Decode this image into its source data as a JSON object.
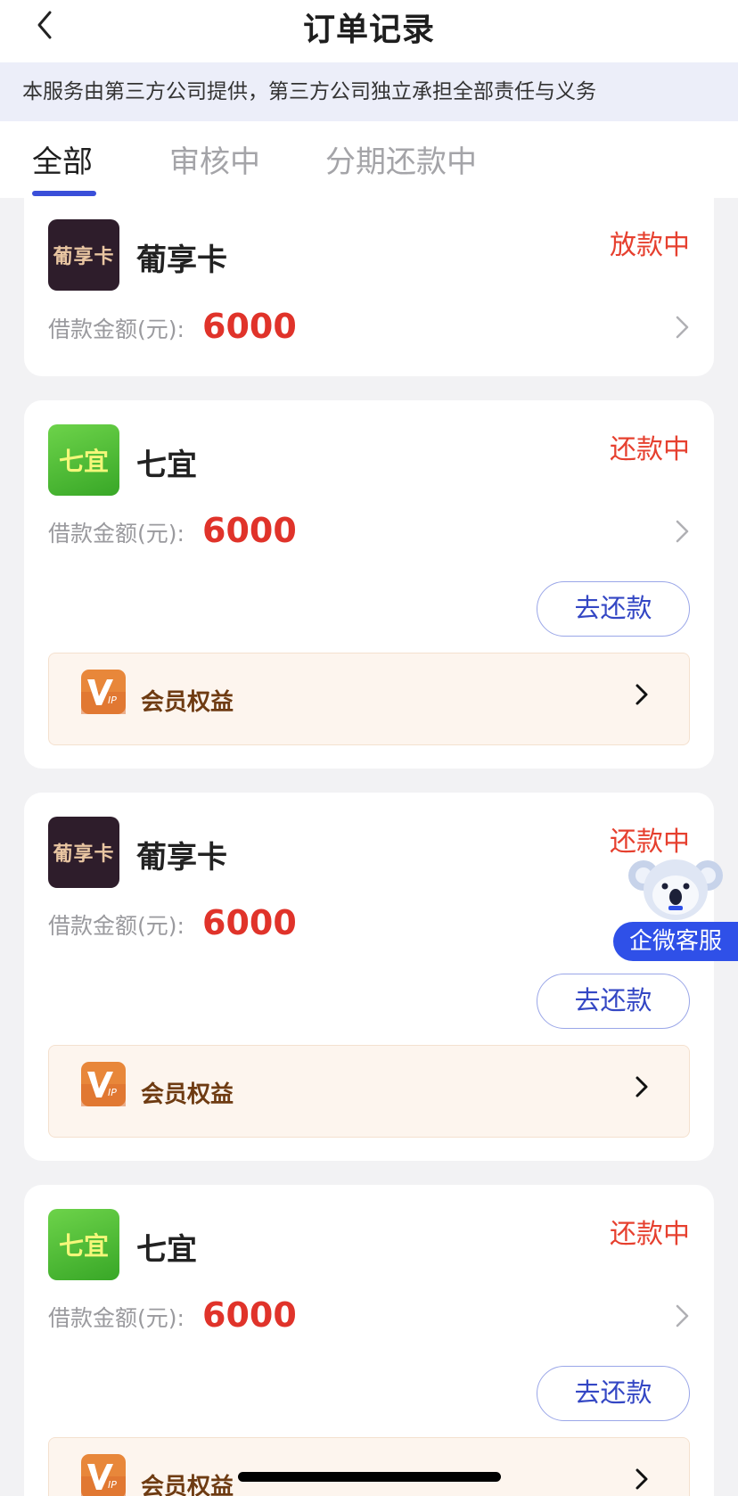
{
  "header": {
    "title": "订单记录"
  },
  "notice": "本服务由第三方公司提供，第三方公司独立承担全部责任与义务",
  "tabs": [
    {
      "label": "全部",
      "active": true
    },
    {
      "label": "审核中",
      "active": false
    },
    {
      "label": "分期还款中",
      "active": false
    }
  ],
  "orders": [
    {
      "logo_text": "葡享卡",
      "logo_style": "dark",
      "name": "葡享卡",
      "status": "放款中",
      "amount_label": "借款金额(元):",
      "amount": "6000"
    },
    {
      "logo_text": "七宜",
      "logo_style": "green",
      "name": "七宜",
      "status": "还款中",
      "amount_label": "借款金额(元):",
      "amount": "6000",
      "repay_label": "去还款",
      "vip_label": "会员权益"
    },
    {
      "logo_text": "葡享卡",
      "logo_style": "dark",
      "name": "葡享卡",
      "status": "还款中",
      "amount_label": "借款金额(元):",
      "amount": "6000",
      "repay_label": "去还款",
      "vip_label": "会员权益"
    },
    {
      "logo_text": "七宜",
      "logo_style": "green",
      "name": "七宜",
      "status": "还款中",
      "amount_label": "借款金额(元):",
      "amount": "6000",
      "repay_label": "去还款",
      "vip_label": "会员权益"
    }
  ],
  "service": {
    "label": "企微客服"
  },
  "colors": {
    "accent": "#3a4fd9",
    "status_red": "#e6402f",
    "amount_red": "#e0332a",
    "service_blue": "#2f50e8"
  },
  "icons": {
    "back": "chevron-left-icon",
    "vip": "vip-badge-icon",
    "service": "koala-mascot-icon"
  }
}
